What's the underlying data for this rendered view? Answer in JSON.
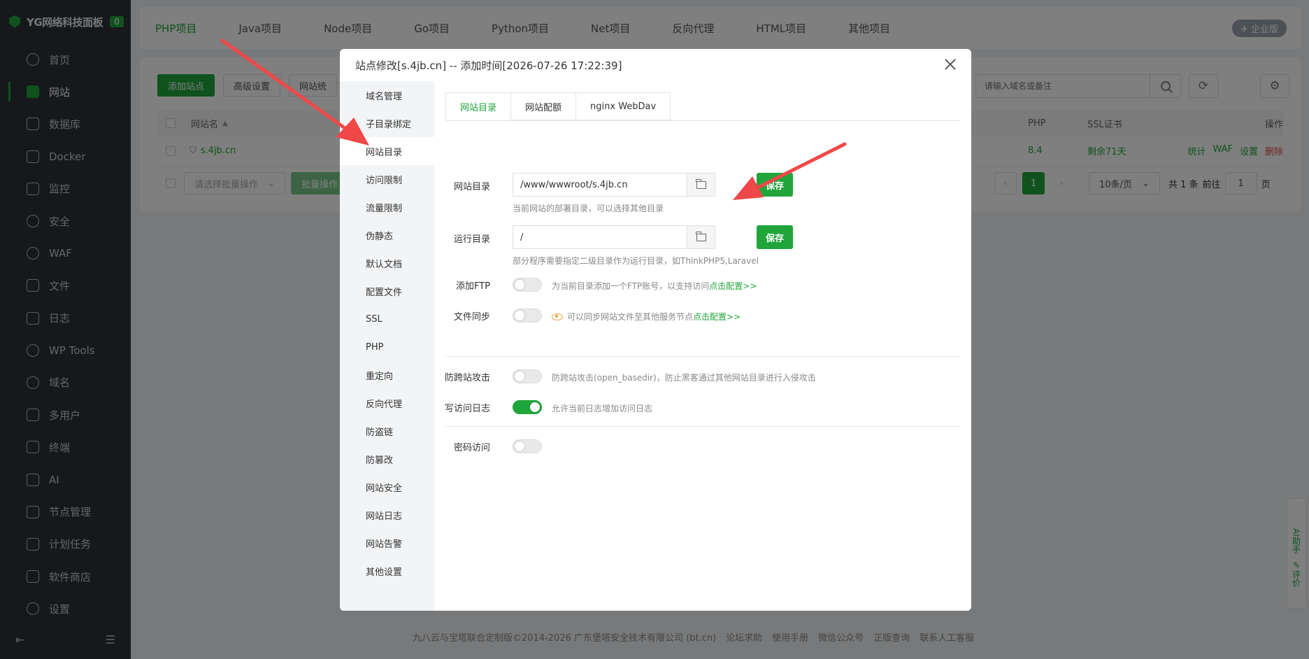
{
  "brand": {
    "name": "YG网络科技面板",
    "badge": "0"
  },
  "sidebar": {
    "items": [
      {
        "label": "首页",
        "icon": "home-icon"
      },
      {
        "label": "网站",
        "icon": "website-icon",
        "active": true
      },
      {
        "label": "数据库",
        "icon": "database-icon"
      },
      {
        "label": "Docker",
        "icon": "docker-icon"
      },
      {
        "label": "监控",
        "icon": "monitor-icon"
      },
      {
        "label": "安全",
        "icon": "shield-icon"
      },
      {
        "label": "WAF",
        "icon": "waf-icon"
      },
      {
        "label": "文件",
        "icon": "folder-icon"
      },
      {
        "label": "日志",
        "icon": "log-icon"
      },
      {
        "label": "WP Tools",
        "icon": "wordpress-icon"
      },
      {
        "label": "域名",
        "icon": "globe-icon"
      },
      {
        "label": "多用户",
        "icon": "users-icon"
      },
      {
        "label": "终端",
        "icon": "terminal-icon"
      },
      {
        "label": "AI",
        "icon": "ai-icon"
      },
      {
        "label": "节点管理",
        "icon": "node-icon"
      },
      {
        "label": "计划任务",
        "icon": "calendar-icon"
      },
      {
        "label": "软件商店",
        "icon": "store-icon"
      },
      {
        "label": "设置",
        "icon": "gear-icon"
      }
    ]
  },
  "topbar": {
    "tabs": [
      "PHP项目",
      "Java项目",
      "Node项目",
      "Go项目",
      "Python项目",
      "Net项目",
      "反向代理",
      "HTML项目",
      "其他项目"
    ],
    "edition": "企业版"
  },
  "toolbar": {
    "add_site": "添加站点",
    "advanced": "高级设置",
    "site_stats": "网站统"
  },
  "search": {
    "placeholder": "请输入域名或备注"
  },
  "table": {
    "headers": {
      "name": "网站名",
      "php": "PHP",
      "ssl": "SSL证书",
      "ops": "操作"
    },
    "row": {
      "name": "s.4jb.cn",
      "php": "8.4",
      "ssl": "剩余71天",
      "ops": [
        "统计",
        "WAF",
        "设置",
        "删除"
      ]
    }
  },
  "pager": {
    "batch_placeholder": "请选择批量操作",
    "batch_btn": "批量操作",
    "page": "1",
    "per_page": "10条/页",
    "total": "共 1 条",
    "goto_prefix": "前往",
    "goto_value": "1",
    "goto_suffix": "页"
  },
  "footer": {
    "copyright": "九八云与宝塔联合定制版©2014-2026 广东堡塔安全技术有限公司 (bt.cn)",
    "links": [
      "论坛求助",
      "使用手册",
      "微信公众号",
      "正版查询",
      "联系人工客服"
    ]
  },
  "ai_side": {
    "assistant": "AI助手",
    "rate": "评价"
  },
  "modal": {
    "title": "站点修改[s.4jb.cn] -- 添加时间[2026-07-26 17:22:39]",
    "menu": [
      "域名管理",
      "子目录绑定",
      "网站目录",
      "访问限制",
      "流量限制",
      "伪静态",
      "默认文档",
      "配置文件",
      "SSL",
      "PHP",
      "重定向",
      "反向代理",
      "防盗链",
      "防篡改",
      "网站安全",
      "网站日志",
      "网站告警",
      "其他设置"
    ],
    "active_menu": 2,
    "sub_tabs": [
      "网站目录",
      "网站配额",
      "nginx WebDav"
    ],
    "site_dir": {
      "label": "网站目录",
      "value": "/www/wwwroot/s.4jb.cn",
      "save": "保存",
      "hint": "当前网站的部署目录，可以选择其他目录"
    },
    "run_dir": {
      "label": "运行目录",
      "value": "/",
      "save": "保存",
      "hint": "部分程序需要指定二级目录作为运行目录，如ThinkPHP5,Laravel"
    },
    "ftp": {
      "label": "添加FTP",
      "hint": "为当前目录添加一个FTP账号，以支持访问",
      "link": "点击配置>>",
      "on": false
    },
    "sync": {
      "label": "文件同步",
      "hint": "可以同步网站文件至其他服务节点",
      "link": "点击配置>>",
      "on": false
    },
    "basedir": {
      "label": "防跨站攻击",
      "hint": "防跨站攻击(open_basedir)，防止黑客通过其他网站目录进行入侵攻击",
      "on": false
    },
    "access_log": {
      "label": "写访问日志",
      "hint": "允许当前日志增加访问日志",
      "on": true
    },
    "password": {
      "label": "密码访问",
      "on": false
    }
  },
  "colors": {
    "accent": "#20a53a",
    "sidebar_bg": "#2c3038",
    "arrow": "#f04848"
  }
}
